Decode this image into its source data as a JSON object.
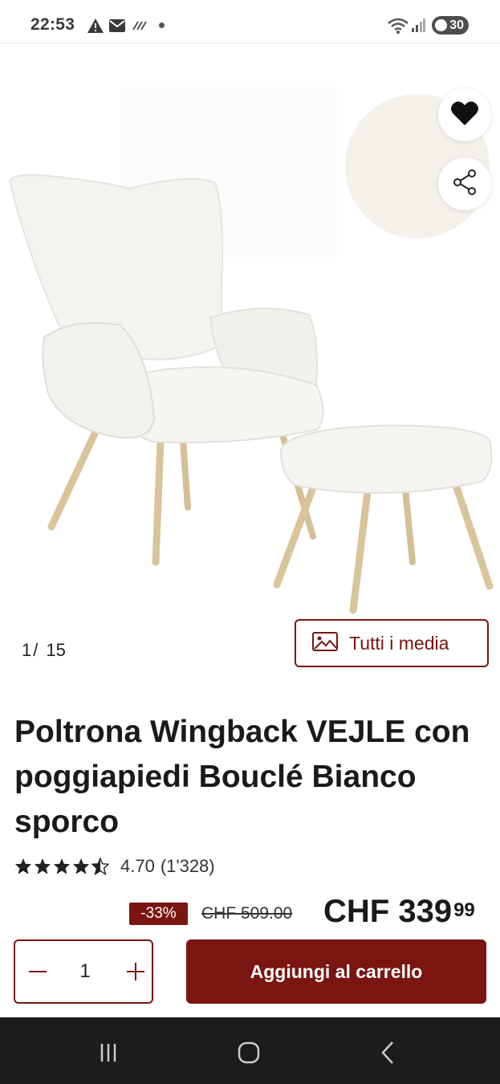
{
  "status_bar": {
    "time": "22:53",
    "icons": [
      "warning-icon",
      "mail-icon",
      "signal-off-icon",
      "notification-dot",
      "wifi-icon",
      "cell-signal-icon"
    ],
    "battery": "30"
  },
  "gallery": {
    "current": "1",
    "separator": "/",
    "total": "15",
    "media_button_label": "Tutti i media",
    "favorite_icon": "heart-icon",
    "share_icon": "share-icon"
  },
  "product": {
    "title": "Poltrona Wingback VEJLE con poggiapiedi Bouclé Bianco sporco",
    "rating": 4.7,
    "rating_text": "4.70",
    "review_count": "(1'328)",
    "discount": "-33%",
    "old_price": "CHF 509.00",
    "price_main": "CHF 339",
    "price_cents": "99"
  },
  "purchase": {
    "quantity": "1",
    "add_to_cart_label": "Aggiungi al carrello"
  },
  "colors": {
    "brand": "#7a1512"
  }
}
